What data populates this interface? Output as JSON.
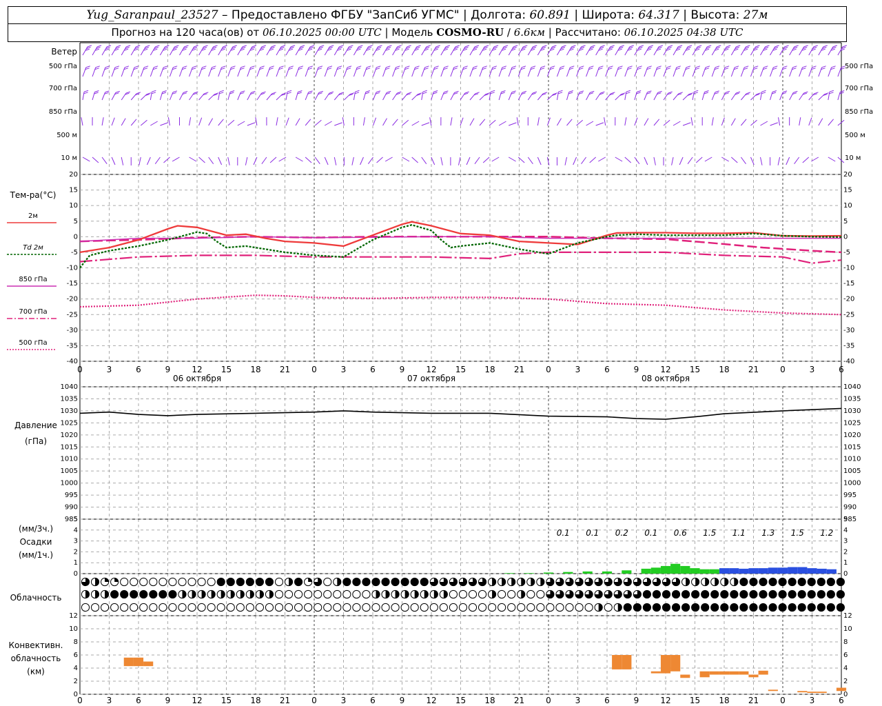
{
  "header": {
    "station": "Yug_Saranpaul_23527",
    "dash": " – ",
    "provider": "Предоставлено ФГБУ \"ЗапСиб УГМС\"",
    "lon_label": "Долгота:",
    "lon": "60.891",
    "lat_label": "Широта:",
    "lat": "64.317",
    "alt_label": "Высота:",
    "alt": "27м",
    "fc_label": "Прогноз на 120 часа(ов) от",
    "fc_from": "06.10.2025 00:00 UTC",
    "model_label": "Модель",
    "model": "COSMO-RU",
    "model_res": "6.6км",
    "calc_label": "Рассчитано:",
    "calc": "06.10.2025 04:38 UTC"
  },
  "labels": {
    "wind_title": "Ветер",
    "wind_levels": [
      "500 гПа",
      "700 гПа",
      "850 гПа",
      "500 м",
      "10 м"
    ],
    "temp_title": "Тем-ра(°С)",
    "legend": [
      "2м",
      "Td 2м",
      "850 гПа",
      "700 гПа",
      "500 гПа"
    ],
    "pressure_title": "Давление",
    "pressure_unit": "(гПа)",
    "precip_unit3": "(мм/3ч.)",
    "precip_title": "Осадки",
    "precip_unit1": "(мм/1ч.)",
    "cloud_title": "Облачность",
    "conv_title": "Конвективн.",
    "conv_title2": "облачность",
    "conv_unit": "(км)",
    "dates": [
      "06 октября",
      "07 октября",
      "08 октября"
    ]
  },
  "colors": {
    "t2m": "#ee3a3a",
    "td2m": "#006600",
    "t850": "#cc2fb2",
    "t700": "#e0207a",
    "t500": "#e0207a",
    "wind": "#8a2be2",
    "precip_green": "#22cc22",
    "precip_blue": "#2a4fe0",
    "conv": "#ee8833"
  },
  "chart_data": [
    {
      "type": "line",
      "panel": "temperature",
      "x_ticks": [
        "0",
        "3",
        "6",
        "9",
        "12",
        "15",
        "18",
        "21",
        "0",
        "3",
        "6",
        "9",
        "12",
        "15",
        "18",
        "21",
        "0",
        "3",
        "6",
        "9",
        "12",
        "15",
        "18",
        "21",
        "0",
        "3",
        "6"
      ],
      "ylim": [
        -40,
        20
      ],
      "y_ticks": [
        20,
        15,
        10,
        5,
        0,
        -5,
        -10,
        -15,
        -20,
        -25,
        -30,
        -35,
        -40
      ],
      "grid": true,
      "series": [
        {
          "name": "2м",
          "x": [
            0,
            3,
            6,
            9,
            10,
            12,
            15,
            17,
            19,
            21,
            24,
            27,
            30,
            33,
            34,
            36,
            39,
            42,
            45,
            48,
            51,
            54,
            55,
            57,
            60,
            63,
            66,
            69,
            72,
            75,
            78
          ],
          "values": [
            -5,
            -3.5,
            -1,
            2.5,
            3.5,
            3,
            0.5,
            0.8,
            -0.5,
            -1.5,
            -2,
            -3,
            0.5,
            4,
            4.8,
            3.5,
            1,
            0.5,
            -1.5,
            -2,
            -2.5,
            0.5,
            1.2,
            1.3,
            1.3,
            1.1,
            1.1,
            1.3,
            0.3,
            0.2,
            0.3
          ]
        },
        {
          "name": "Td 2м",
          "x": [
            0,
            1,
            3,
            6,
            9,
            12,
            13,
            14,
            15,
            17,
            19,
            21,
            24,
            27,
            30,
            33,
            34,
            36,
            37,
            38,
            39,
            42,
            45,
            48,
            51,
            54,
            55,
            57,
            60,
            63,
            66,
            69,
            72,
            75,
            78
          ],
          "values": [
            -10,
            -6,
            -4.5,
            -3,
            -1,
            1.5,
            1,
            -1.5,
            -3.5,
            -3,
            -4,
            -5,
            -6,
            -6.5,
            -1,
            3,
            3.8,
            2,
            -1,
            -3.5,
            -3,
            -2,
            -4,
            -5.5,
            -2,
            0,
            0.5,
            0.8,
            0.5,
            0.5,
            0.5,
            1,
            0.3,
            0,
            -0.1
          ]
        },
        {
          "name": "850 гПа",
          "x": [
            0,
            6,
            12,
            18,
            24,
            30,
            36,
            42,
            48,
            54,
            60,
            66,
            72,
            78
          ],
          "values": [
            -1.5,
            -0.5,
            -0.5,
            0,
            -0.3,
            -0.2,
            0,
            0,
            -0.5,
            -0.5,
            -0.5,
            -0.5,
            -0.5,
            -0.5
          ]
        },
        {
          "name": "700 гПа",
          "x": [
            0,
            3,
            6,
            12,
            18,
            24,
            30,
            36,
            42,
            48,
            54,
            60,
            64,
            70,
            75,
            78
          ],
          "values": [
            -1.5,
            -1.2,
            -1,
            -0.3,
            0,
            -0.3,
            0,
            0,
            0,
            0,
            -0.5,
            -0.8,
            -1.8,
            -3.5,
            -4.5,
            -5
          ]
        },
        {
          "name": "700 гПа (dash-dot)",
          "x": [
            0,
            6,
            12,
            18,
            24,
            30,
            36,
            42,
            45,
            48,
            54,
            60,
            66,
            72,
            75,
            78
          ],
          "values": [
            -8,
            -6.5,
            -6,
            -6,
            -6.5,
            -6.5,
            -6.5,
            -7,
            -5.5,
            -5,
            -5,
            -5,
            -6,
            -6.5,
            -8.5,
            -7.5
          ]
        },
        {
          "name": "500 гПа",
          "x": [
            0,
            6,
            12,
            18,
            21,
            24,
            30,
            36,
            42,
            48,
            54,
            60,
            66,
            72,
            78
          ],
          "values": [
            -22.5,
            -22,
            -20,
            -18.8,
            -19,
            -19.5,
            -19.8,
            -19.5,
            -19.5,
            -20,
            -21.5,
            -22,
            -23.5,
            -24.5,
            -25
          ]
        }
      ]
    },
    {
      "type": "line",
      "panel": "pressure",
      "ylim": [
        985,
        1040
      ],
      "y_ticks": [
        1040,
        1035,
        1030,
        1025,
        1020,
        1015,
        1010,
        1005,
        1000,
        995,
        990,
        985
      ],
      "series": [
        {
          "name": "Давление",
          "x": [
            0,
            3,
            6,
            9,
            12,
            18,
            24,
            27,
            30,
            36,
            42,
            48,
            54,
            57,
            60,
            63,
            66,
            72,
            78
          ],
          "values": [
            1029,
            1029.5,
            1028.5,
            1028,
            1028.5,
            1029,
            1029.5,
            1030,
            1029.5,
            1029,
            1029,
            1027.8,
            1027.5,
            1026.8,
            1026.5,
            1027.5,
            1028.8,
            1030,
            1031
          ]
        }
      ]
    },
    {
      "type": "bar",
      "panel": "precipitation",
      "ylim": [
        0,
        5
      ],
      "y_ticks": [
        5,
        4,
        3,
        2,
        1,
        0
      ],
      "three_hour_totals": [
        "0.1",
        "0.1",
        "0.2",
        "0.1",
        "0.6",
        "1.5",
        "1.1",
        "1.3",
        "1.5",
        "1.2"
      ],
      "series": [
        {
          "name": "мм/1ч (зелёный)",
          "x": [
            44,
            46,
            48,
            50,
            52,
            54,
            56,
            58,
            59,
            60,
            61,
            62,
            63,
            64,
            65
          ],
          "values": [
            0.05,
            0.05,
            0.1,
            0.15,
            0.2,
            0.2,
            0.3,
            0.45,
            0.55,
            0.7,
            0.9,
            0.7,
            0.5,
            0.4,
            0.4
          ]
        },
        {
          "name": "мм/1ч (синий)",
          "x": [
            66,
            67,
            68,
            69,
            70,
            71,
            72,
            73,
            74,
            75,
            76,
            77
          ],
          "values": [
            0.5,
            0.5,
            0.45,
            0.5,
            0.5,
            0.55,
            0.55,
            0.6,
            0.6,
            0.5,
            0.45,
            0.4
          ]
        }
      ]
    },
    {
      "type": "bar",
      "panel": "convective cloud",
      "ylim": [
        0,
        12
      ],
      "y_ticks": [
        12,
        10,
        8,
        6,
        4,
        2,
        0
      ],
      "series": [
        {
          "name": "Конвективная облачность",
          "x": [
            5,
            6,
            7,
            55,
            56,
            59,
            60,
            61,
            62,
            64,
            65,
            66,
            67,
            68,
            69,
            70,
            71,
            74,
            75,
            76,
            78
          ],
          "base": [
            4.3,
            4.3,
            4.3,
            3.8,
            3.8,
            3.2,
            3.2,
            3.5,
            2.5,
            2.6,
            3.0,
            3.0,
            3.0,
            3.0,
            2.6,
            3.0,
            0.5,
            0.3,
            0.2,
            0.2,
            0.5
          ],
          "top": [
            5.6,
            5.6,
            5.0,
            6.0,
            6.0,
            3.5,
            6.0,
            6.0,
            3.0,
            3.5,
            3.5,
            3.5,
            3.5,
            3.5,
            3.0,
            3.6,
            0.7,
            0.5,
            0.4,
            0.4,
            1.0
          ]
        }
      ]
    }
  ]
}
